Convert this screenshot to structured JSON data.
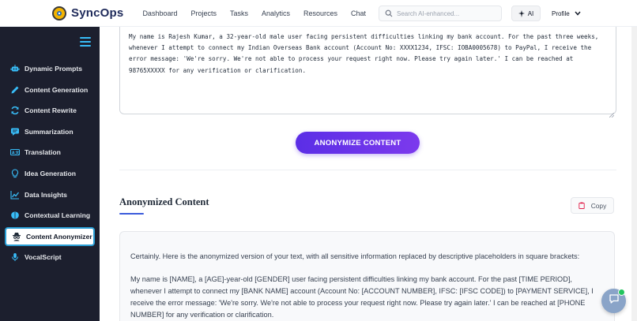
{
  "app": {
    "brand_name": "SyncOps",
    "accent": "#5b2ee6",
    "sidebar_bg": "#1c1f2e"
  },
  "nav": {
    "items": [
      "Dashboard",
      "Projects",
      "Tasks",
      "Analytics",
      "Resources",
      "Chat"
    ]
  },
  "search": {
    "placeholder": "Search AI-enhanced..."
  },
  "ai_button": {
    "label": "AI"
  },
  "profile": {
    "label": "Profile"
  },
  "sidebar": {
    "items": [
      {
        "label": "Dynamic Prompts",
        "icon": "robot-icon"
      },
      {
        "label": "Content Generation",
        "icon": "pencil-icon"
      },
      {
        "label": "Content Rewrite",
        "icon": "refresh-icon"
      },
      {
        "label": "Summarization",
        "icon": "chat-bubble-icon"
      },
      {
        "label": "Translation",
        "icon": "translate-icon"
      },
      {
        "label": "Idea Generation",
        "icon": "lightbulb-icon"
      },
      {
        "label": "Data Insights",
        "icon": "chart-line-icon"
      },
      {
        "label": "Contextual Learning",
        "icon": "brain-icon"
      },
      {
        "label": "Content Anonymizer",
        "icon": "spy-icon",
        "active": true
      },
      {
        "label": "VocalScript",
        "icon": "microphone-icon"
      }
    ]
  },
  "input": {
    "text": "My name is Rajesh Kumar, a 32-year-old male user facing persistent difficulties linking my bank account. For the past three weeks, whenever I attempt to connect my Indian Overseas Bank account (Account No: XXXX1234, IFSC: IOBA0005678) to PayPal, I receive the error message: 'We're sorry. We're not able to process your request right now. Please try again later.' I can be reached at 98765XXXXX for any verification or clarification."
  },
  "anonymize_button": {
    "label": "ANONYMIZE CONTENT"
  },
  "output": {
    "title": "Anonymized Content",
    "copy_label": "Copy",
    "intro": "Certainly. Here is the anonymized version of your text, with all sensitive information replaced by descriptive placeholders in square brackets:",
    "body": "My name is [NAME], a [AGE]-year-old [GENDER] user facing persistent difficulties linking my bank account. For the past [TIME PERIOD], whenever I attempt to connect my [BANK NAME] account (Account No: [ACCOUNT NUMBER], IFSC: [IFSC CODE]) to [PAYMENT SERVICE], I receive the error message: 'We're sorry. We're not able to process your request right now. Please try again later.' I can be reached at [PHONE NUMBER] for any verification or clarification."
  }
}
